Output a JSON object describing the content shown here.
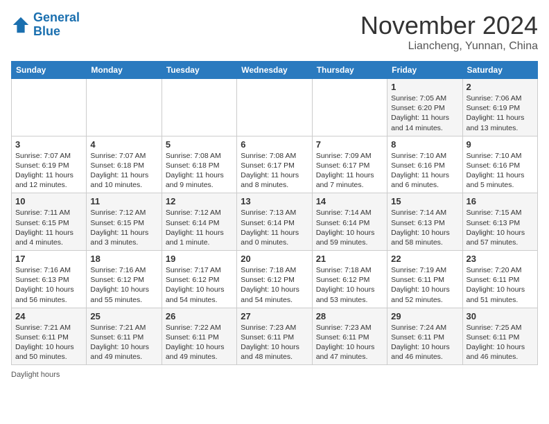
{
  "header": {
    "logo_line1": "General",
    "logo_line2": "Blue",
    "month_title": "November 2024",
    "location": "Liancheng, Yunnan, China"
  },
  "days_of_week": [
    "Sunday",
    "Monday",
    "Tuesday",
    "Wednesday",
    "Thursday",
    "Friday",
    "Saturday"
  ],
  "weeks": [
    [
      {
        "day": "",
        "info": ""
      },
      {
        "day": "",
        "info": ""
      },
      {
        "day": "",
        "info": ""
      },
      {
        "day": "",
        "info": ""
      },
      {
        "day": "",
        "info": ""
      },
      {
        "day": "1",
        "info": "Sunrise: 7:05 AM\nSunset: 6:20 PM\nDaylight: 11 hours and 14 minutes."
      },
      {
        "day": "2",
        "info": "Sunrise: 7:06 AM\nSunset: 6:19 PM\nDaylight: 11 hours and 13 minutes."
      }
    ],
    [
      {
        "day": "3",
        "info": "Sunrise: 7:07 AM\nSunset: 6:19 PM\nDaylight: 11 hours and 12 minutes."
      },
      {
        "day": "4",
        "info": "Sunrise: 7:07 AM\nSunset: 6:18 PM\nDaylight: 11 hours and 10 minutes."
      },
      {
        "day": "5",
        "info": "Sunrise: 7:08 AM\nSunset: 6:18 PM\nDaylight: 11 hours and 9 minutes."
      },
      {
        "day": "6",
        "info": "Sunrise: 7:08 AM\nSunset: 6:17 PM\nDaylight: 11 hours and 8 minutes."
      },
      {
        "day": "7",
        "info": "Sunrise: 7:09 AM\nSunset: 6:17 PM\nDaylight: 11 hours and 7 minutes."
      },
      {
        "day": "8",
        "info": "Sunrise: 7:10 AM\nSunset: 6:16 PM\nDaylight: 11 hours and 6 minutes."
      },
      {
        "day": "9",
        "info": "Sunrise: 7:10 AM\nSunset: 6:16 PM\nDaylight: 11 hours and 5 minutes."
      }
    ],
    [
      {
        "day": "10",
        "info": "Sunrise: 7:11 AM\nSunset: 6:15 PM\nDaylight: 11 hours and 4 minutes."
      },
      {
        "day": "11",
        "info": "Sunrise: 7:12 AM\nSunset: 6:15 PM\nDaylight: 11 hours and 3 minutes."
      },
      {
        "day": "12",
        "info": "Sunrise: 7:12 AM\nSunset: 6:14 PM\nDaylight: 11 hours and 1 minute."
      },
      {
        "day": "13",
        "info": "Sunrise: 7:13 AM\nSunset: 6:14 PM\nDaylight: 11 hours and 0 minutes."
      },
      {
        "day": "14",
        "info": "Sunrise: 7:14 AM\nSunset: 6:14 PM\nDaylight: 10 hours and 59 minutes."
      },
      {
        "day": "15",
        "info": "Sunrise: 7:14 AM\nSunset: 6:13 PM\nDaylight: 10 hours and 58 minutes."
      },
      {
        "day": "16",
        "info": "Sunrise: 7:15 AM\nSunset: 6:13 PM\nDaylight: 10 hours and 57 minutes."
      }
    ],
    [
      {
        "day": "17",
        "info": "Sunrise: 7:16 AM\nSunset: 6:13 PM\nDaylight: 10 hours and 56 minutes."
      },
      {
        "day": "18",
        "info": "Sunrise: 7:16 AM\nSunset: 6:12 PM\nDaylight: 10 hours and 55 minutes."
      },
      {
        "day": "19",
        "info": "Sunrise: 7:17 AM\nSunset: 6:12 PM\nDaylight: 10 hours and 54 minutes."
      },
      {
        "day": "20",
        "info": "Sunrise: 7:18 AM\nSunset: 6:12 PM\nDaylight: 10 hours and 54 minutes."
      },
      {
        "day": "21",
        "info": "Sunrise: 7:18 AM\nSunset: 6:12 PM\nDaylight: 10 hours and 53 minutes."
      },
      {
        "day": "22",
        "info": "Sunrise: 7:19 AM\nSunset: 6:11 PM\nDaylight: 10 hours and 52 minutes."
      },
      {
        "day": "23",
        "info": "Sunrise: 7:20 AM\nSunset: 6:11 PM\nDaylight: 10 hours and 51 minutes."
      }
    ],
    [
      {
        "day": "24",
        "info": "Sunrise: 7:21 AM\nSunset: 6:11 PM\nDaylight: 10 hours and 50 minutes."
      },
      {
        "day": "25",
        "info": "Sunrise: 7:21 AM\nSunset: 6:11 PM\nDaylight: 10 hours and 49 minutes."
      },
      {
        "day": "26",
        "info": "Sunrise: 7:22 AM\nSunset: 6:11 PM\nDaylight: 10 hours and 49 minutes."
      },
      {
        "day": "27",
        "info": "Sunrise: 7:23 AM\nSunset: 6:11 PM\nDaylight: 10 hours and 48 minutes."
      },
      {
        "day": "28",
        "info": "Sunrise: 7:23 AM\nSunset: 6:11 PM\nDaylight: 10 hours and 47 minutes."
      },
      {
        "day": "29",
        "info": "Sunrise: 7:24 AM\nSunset: 6:11 PM\nDaylight: 10 hours and 46 minutes."
      },
      {
        "day": "30",
        "info": "Sunrise: 7:25 AM\nSunset: 6:11 PM\nDaylight: 10 hours and 46 minutes."
      }
    ]
  ],
  "footer": {
    "daylight_label": "Daylight hours"
  }
}
